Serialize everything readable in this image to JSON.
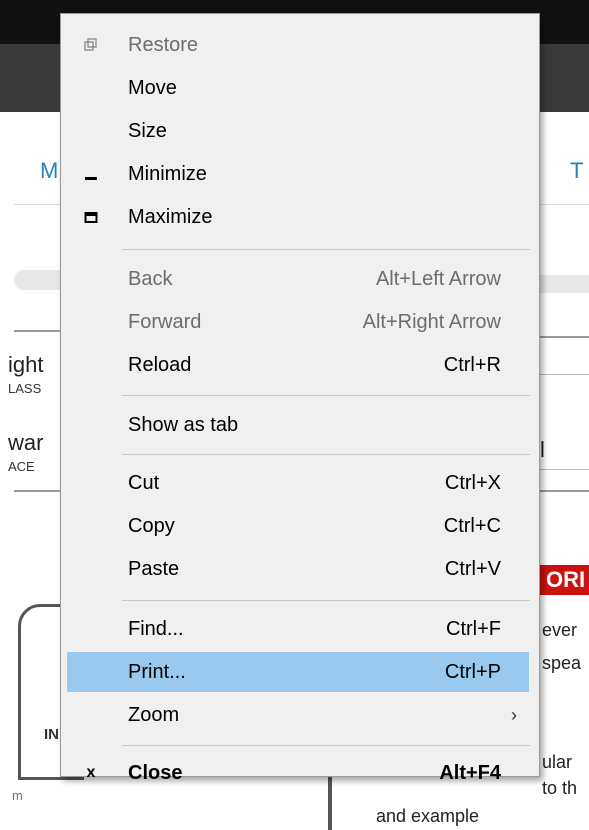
{
  "background": {
    "nav_left_letter": "M",
    "nav_right_letter": "T",
    "left_texts": [
      "ight",
      "LASS",
      "war",
      "ACE",
      "IN",
      "m"
    ],
    "right_texts": [
      "l",
      "ORI",
      "ever",
      "spea",
      "ular",
      "to th",
      "and example"
    ]
  },
  "menu": {
    "items": [
      {
        "label": "Restore",
        "shortcut": "",
        "icon": "restore-icon",
        "disabled": true
      },
      {
        "label": "Move",
        "shortcut": "",
        "disabled": false
      },
      {
        "label": "Size",
        "shortcut": "",
        "disabled": false
      },
      {
        "label": "Minimize",
        "shortcut": "",
        "icon": "minimize-icon",
        "disabled": false
      },
      {
        "label": "Maximize",
        "shortcut": "",
        "icon": "maximize-icon",
        "disabled": false
      },
      {
        "label": "Back",
        "shortcut": "Alt+Left Arrow",
        "disabled": true
      },
      {
        "label": "Forward",
        "shortcut": "Alt+Right Arrow",
        "disabled": true
      },
      {
        "label": "Reload",
        "shortcut": "Ctrl+R",
        "disabled": false
      },
      {
        "label": "Show as tab",
        "shortcut": "",
        "disabled": false
      },
      {
        "label": "Cut",
        "shortcut": "Ctrl+X",
        "disabled": false
      },
      {
        "label": "Copy",
        "shortcut": "Ctrl+C",
        "disabled": false
      },
      {
        "label": "Paste",
        "shortcut": "Ctrl+V",
        "disabled": false
      },
      {
        "label": "Find...",
        "shortcut": "Ctrl+F",
        "disabled": false
      },
      {
        "label": "Print...",
        "shortcut": "Ctrl+P",
        "disabled": false,
        "selected": true
      },
      {
        "label": "Zoom",
        "shortcut": "",
        "submenu": true,
        "disabled": false
      },
      {
        "label": "Close",
        "shortcut": "Alt+F4",
        "icon": "close-icon",
        "disabled": false,
        "bold": true
      }
    ]
  },
  "colors": {
    "highlight": "#99c9ef",
    "menu_bg": "#f0f0f0",
    "accent_red": "#cc1111"
  }
}
